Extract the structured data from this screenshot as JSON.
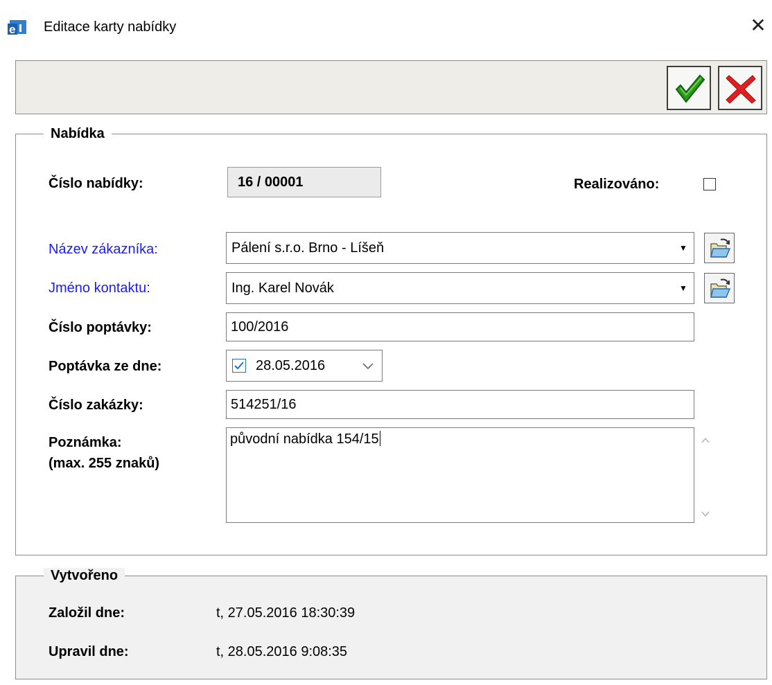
{
  "window": {
    "title": "Editace karty nabídky",
    "close_glyph": "✕"
  },
  "icons": {
    "app": "app-e-icon",
    "ok": "checkmark-icon",
    "cancel": "red-x-icon",
    "picker": "open-folder-icon",
    "date_chevron": "chevron-down-icon",
    "scroll_up": "chevron-up-icon",
    "scroll_down": "chevron-down-icon"
  },
  "colors": {
    "accent_blue": "#1a1aff",
    "ok_green": "#2a9a1a",
    "cancel_red": "#e02020",
    "toolbar_bg": "#eeede8",
    "group_bg": "#f1f1f1"
  },
  "offer": {
    "legend": "Nabídka",
    "offer_no_label": "Číslo nabídky:",
    "offer_no_value": "16 / 00001",
    "realized_label": "Realizováno:",
    "realized_checked": false,
    "customer_label": "Název zákazníka:",
    "customer_value": "Pálení s.r.o. Brno - Líšeň",
    "contact_label": "Jméno kontaktu:",
    "contact_value": "Ing. Karel Novák",
    "inquiry_no_label": "Číslo poptávky:",
    "inquiry_no_value": "100/2016",
    "inquiry_date_label": "Poptávka ze dne:",
    "inquiry_date_value": "28.05.2016",
    "inquiry_date_checked": true,
    "order_no_label": "Číslo zakázky:",
    "order_no_value": "514251/16",
    "note_label": "Poznámka:",
    "note_hint": "(max. 255 znaků)",
    "note_value": "původní nabídka 154/15"
  },
  "created": {
    "legend": "Vytvořeno",
    "created_label": "Založil dne:",
    "created_value": "t, 27.05.2016 18:30:39",
    "modified_label": "Upravil dne:",
    "modified_value": "t, 28.05.2016 9:08:35"
  }
}
